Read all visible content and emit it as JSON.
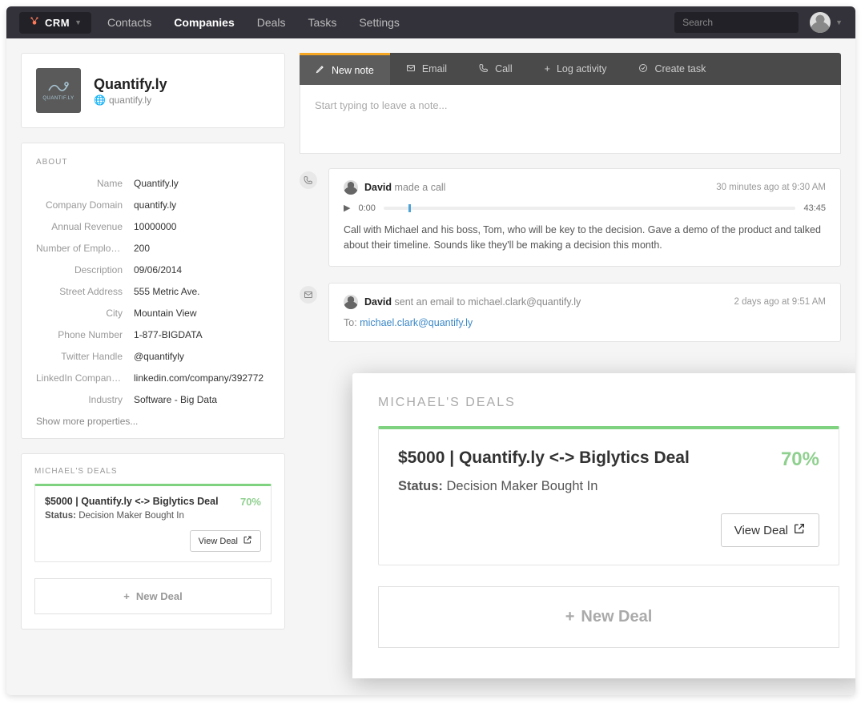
{
  "brand": "CRM",
  "nav": {
    "items": [
      "Contacts",
      "Companies",
      "Deals",
      "Tasks",
      "Settings"
    ],
    "active": "Companies",
    "search_placeholder": "Search"
  },
  "company": {
    "name": "Quantify.ly",
    "domain": "quantify.ly",
    "logo_text": "QUANTIF.LY"
  },
  "about": {
    "title": "ABOUT",
    "properties": [
      {
        "label": "Name",
        "value": "Quantify.ly"
      },
      {
        "label": "Company Domain",
        "value": "quantify.ly"
      },
      {
        "label": "Annual Revenue",
        "value": "10000000"
      },
      {
        "label": "Number of Employ...",
        "value": "200"
      },
      {
        "label": "Description",
        "value": "09/06/2014"
      },
      {
        "label": "Street Address",
        "value": "555 Metric Ave."
      },
      {
        "label": "City",
        "value": "Mountain View"
      },
      {
        "label": "Phone Number",
        "value": "1-877-BIGDATA"
      },
      {
        "label": "Twitter Handle",
        "value": "@quantifyly"
      },
      {
        "label": "LinkedIn Company...",
        "value": "linkedin.com/company/392772"
      },
      {
        "label": "Industry",
        "value": "Software - Big Data"
      }
    ],
    "show_more": "Show more properties..."
  },
  "deals": {
    "title": "MICHAEL'S DEALS",
    "deal": {
      "title": "$5000 | Quantify.ly <-> Biglytics Deal",
      "pct": "70%",
      "status_label": "Status:",
      "status_value": "Decision Maker Bought In",
      "view_label": "View Deal"
    },
    "new_deal_label": "New Deal"
  },
  "activity": {
    "tabs": {
      "new_note": "New note",
      "email": "Email",
      "call": "Call",
      "log_activity": "Log activity",
      "create_task": "Create task"
    },
    "note_placeholder": "Start typing to leave a note...",
    "events": [
      {
        "kind": "call",
        "actor": "David",
        "action_text": "made a call",
        "time": "30 minutes ago at 9:30 AM",
        "audio": {
          "pos": "0:00",
          "dur": "43:45"
        },
        "body": "Call with Michael and his boss, Tom, who will be key to the decision. Gave a demo of the product and talked about their timeline. Sounds like they'll be making a decision this month."
      },
      {
        "kind": "email",
        "actor": "David",
        "action_text": "sent an email to michael.clark@quantify.ly",
        "time": "2 days ago at 9:51 AM",
        "to_label": "To:",
        "to_addr": "michael.clark@quantify.ly"
      }
    ]
  },
  "overlay": {
    "title": "MICHAEL'S DEALS"
  }
}
